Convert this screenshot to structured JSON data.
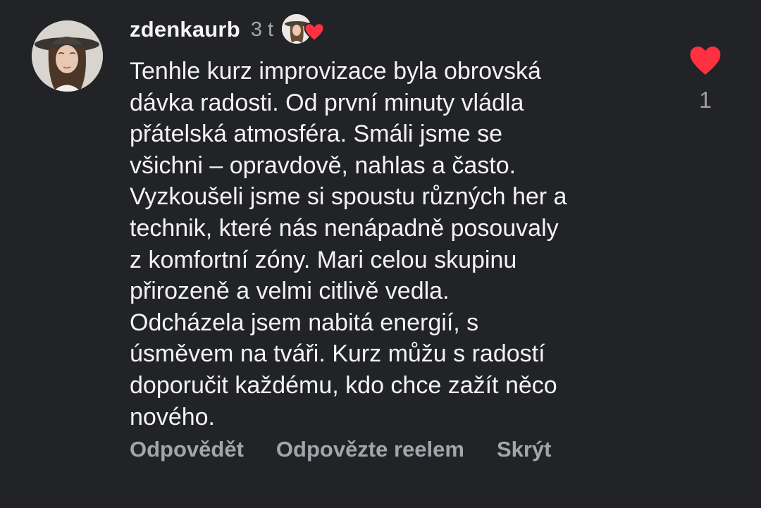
{
  "comment": {
    "username": "zdenkaurb",
    "time": "3 t",
    "text": "Tenhle kurz improvizace byla obrovská\ndávka radosti. Od první minuty vládla\npřátelská atmosféra. Smáli jsme se\nvšichni – opravdově, nahlas a často.\nVyzkoušeli jsme si spoustu různých her a\ntechnik, které nás nenápadně posouvaly\nz komfortní zóny. Mari celou skupinu\npřirozeně a velmi citlivě vedla.\nOdcházela jsem nabitá energií, s\núsměvem na tváři. Kurz můžu s radostí\ndoporučit každému, kdo chce zažít něco\nnového.",
    "like_count": "1",
    "creator_liked_icon": "heart-icon",
    "like_icon": "heart-icon"
  },
  "actions": {
    "reply": "Odpovědět",
    "reply_reel": "Odpovězte reelem",
    "hide": "Skrýt"
  },
  "colors": {
    "background": "#222327",
    "heart": "#ff3040",
    "muted": "#a3a5ab"
  }
}
